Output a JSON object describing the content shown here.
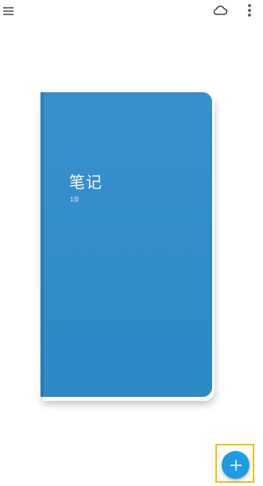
{
  "toolbar": {
    "menu_icon": "hamburger-menu-icon",
    "sync_icon": "cloud-icon",
    "more_icon": "more-vert-icon"
  },
  "notebook": {
    "title": "笔记",
    "pages_label": "1页",
    "cover_color": "#2e8ccb"
  },
  "fab": {
    "icon": "plus-icon",
    "color": "#1e9be5",
    "highlight_color": "#f2c012"
  }
}
